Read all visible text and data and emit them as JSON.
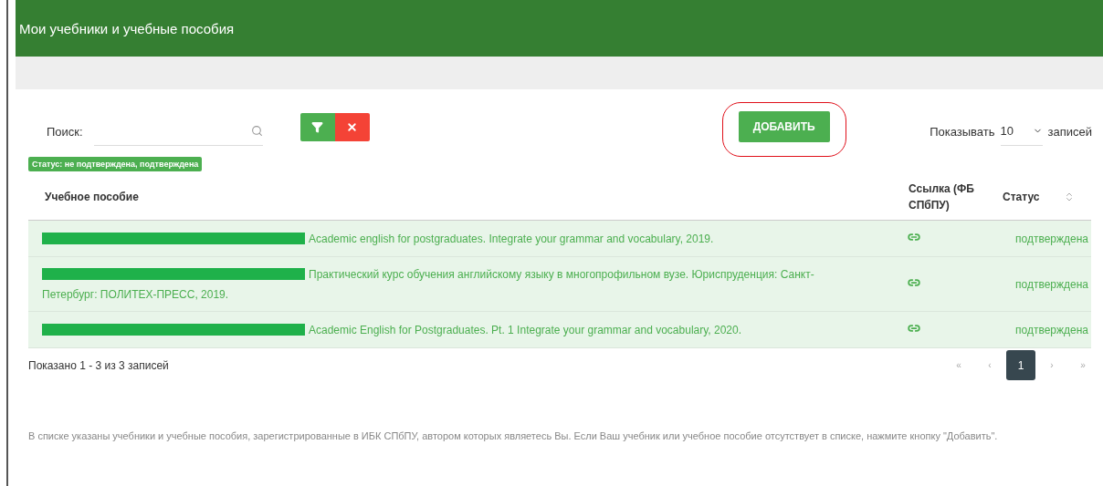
{
  "header": {
    "title": "Мои учебники и учебные пособия"
  },
  "search": {
    "label": "Поиск:"
  },
  "filter_buttons": [
    {
      "kind": "filter"
    },
    {
      "kind": "clear"
    }
  ],
  "add_button": {
    "label": "ДОБАВИТЬ",
    "highlighted": true
  },
  "page_size": {
    "label_before": "Показывать",
    "value": "10",
    "label_after": "записей"
  },
  "filter_tag": "Статус: не подтверждена, подтверждена",
  "table": {
    "columns": [
      "Учебное пособие",
      "Ссылка (ФБ СПбПУ)",
      "Статус"
    ],
    "rows": [
      {
        "author_redacted": true,
        "title": "Academic english for postgraduates. Integrate your grammar and vocabulary, 2019.",
        "status": "подтверждена"
      },
      {
        "author_redacted": true,
        "title": "Практический курс обучения английскому языку в многопрофильном вузе. Юриспруденция: Санкт-Петербург: ПОЛИТЕХ-ПРЕСС, 2019.",
        "status": "подтверждена"
      },
      {
        "author_redacted": true,
        "title": "Academic English for Postgraduates. Pt. 1 Integrate your grammar and vocabulary, 2020.",
        "status": "подтверждена"
      }
    ]
  },
  "summary": "Показано 1 - 3 из 3 записей",
  "pagination": [
    {
      "label": "«",
      "selected": false
    },
    {
      "label": "‹",
      "selected": false
    },
    {
      "label": "1",
      "selected": true
    },
    {
      "label": "›",
      "selected": false
    },
    {
      "label": "»",
      "selected": false
    }
  ],
  "note": "В списке указаны учебники и учебные пособия, зарегистрированные в ИБК СПбПУ, автором которых являетесь Вы. Если Ваш учебник или учебное пособие отсутствует в списке, нажмите кнопку \"Добавить\"."
}
